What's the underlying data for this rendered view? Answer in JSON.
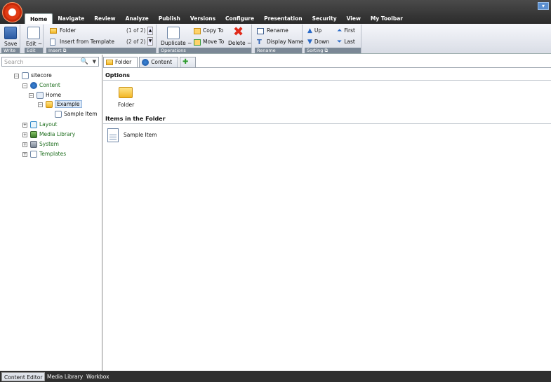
{
  "colors": {
    "accent": "#c62a0a",
    "topbar": "#2b2b2b",
    "ribbon_label": "#7b8896",
    "tree_green": "#1e6e1e"
  },
  "ribbon_tabs": [
    "Home",
    "Navigate",
    "Review",
    "Analyze",
    "Publish",
    "Versions",
    "Configure",
    "Presentation",
    "Security",
    "View",
    "My Toolbar"
  ],
  "ribbon": {
    "write": {
      "label": "Write",
      "save": "Save"
    },
    "edit": {
      "label": "Edit",
      "edit": "Edit ~"
    },
    "insert": {
      "label": "Insert",
      "items": [
        {
          "label": "Folder",
          "count": "(1 of 2)"
        },
        {
          "label": "Insert from Template",
          "count": "(2 of 2)"
        }
      ]
    },
    "operations": {
      "label": "Operations",
      "duplicate": "Duplicate ~",
      "copy_to": "Copy To",
      "move_to": "Move To",
      "delete": "Delete ~"
    },
    "rename": {
      "label": "Rename",
      "rename": "Rename",
      "display_name": "Display Name"
    },
    "sorting": {
      "label": "Sorting",
      "up": "Up",
      "down": "Down",
      "first": "First",
      "last": "Last"
    }
  },
  "search": {
    "placeholder": "Search"
  },
  "tree": {
    "root": "sitecore",
    "content": "Content",
    "home": "Home",
    "example": "Example",
    "sample_item": "Sample Item",
    "layout": "Layout",
    "media_library": "Media Library",
    "system": "System",
    "templates": "Templates"
  },
  "editor_tabs": [
    "Folder",
    "Content",
    ""
  ],
  "editor": {
    "options_title": "Options",
    "options_item": "Folder",
    "items_title": "Items in the Folder",
    "items": [
      "Sample Item"
    ]
  },
  "bottom_tabs": [
    "Content Editor",
    "Media Library",
    "Workbox"
  ]
}
